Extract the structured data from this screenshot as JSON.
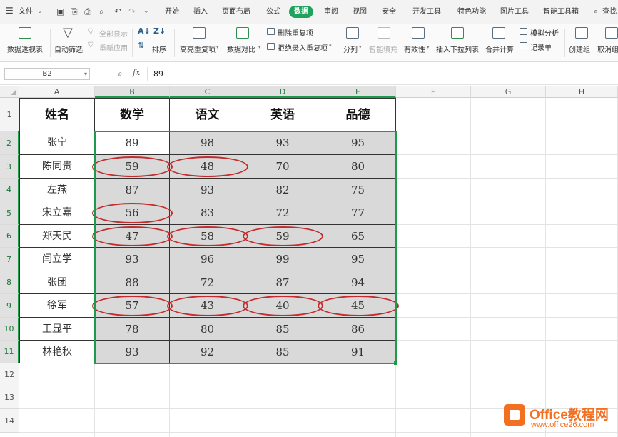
{
  "menubar": {
    "file": "文件",
    "tabs": [
      "开始",
      "插入",
      "页面布局",
      "公式",
      "数据",
      "审阅",
      "视图",
      "安全",
      "开发工具",
      "特色功能",
      "图片工具",
      "智能工具箱"
    ],
    "active_tab": "数据",
    "search": "查找"
  },
  "ribbon": {
    "pivot": "数据透视表",
    "autofilter": "自动筛选",
    "show_all": "全部显示",
    "reapply": "重新应用",
    "sort": "排序",
    "highlight_dup": "高亮重复项",
    "compare": "数据对比",
    "remove_dup": "删除重复项",
    "reject_dup": "拒绝录入重复项",
    "split": "分列",
    "smart_fill": "智能填充",
    "validity": "有效性",
    "dropdown_list": "插入下拉列表",
    "consolidate": "合并计算",
    "simulate": "模拟分析",
    "record_form": "记录单",
    "create_group": "创建组",
    "ungroup": "取消组"
  },
  "formula_bar": {
    "name_box": "B2",
    "fx": "fx",
    "value": "89"
  },
  "grid": {
    "columns": [
      "A",
      "B",
      "C",
      "D",
      "E",
      "F",
      "G",
      "H"
    ],
    "rows": [
      "1",
      "2",
      "3",
      "4",
      "5",
      "6",
      "7",
      "8",
      "9",
      "10",
      "11",
      "12",
      "13",
      "14"
    ],
    "headers": [
      "姓名",
      "数学",
      "语文",
      "英语",
      "品德"
    ],
    "records": [
      [
        "张宁",
        "89",
        "98",
        "93",
        "95"
      ],
      [
        "陈同贵",
        "59",
        "48",
        "70",
        "80"
      ],
      [
        "左燕",
        "87",
        "93",
        "82",
        "75"
      ],
      [
        "宋立嘉",
        "56",
        "83",
        "72",
        "77"
      ],
      [
        "郑天民",
        "47",
        "58",
        "59",
        "65"
      ],
      [
        "闫立学",
        "93",
        "96",
        "99",
        "95"
      ],
      [
        "张团",
        "88",
        "72",
        "87",
        "94"
      ],
      [
        "徐军",
        "57",
        "43",
        "40",
        "45"
      ],
      [
        "王显平",
        "78",
        "80",
        "85",
        "86"
      ],
      [
        "林艳秋",
        "93",
        "92",
        "85",
        "91"
      ]
    ],
    "selected_cell": "B2",
    "selected_range": "B2:E11",
    "circled_cells": [
      "B3",
      "C3",
      "B5",
      "B6",
      "C6",
      "D6",
      "B9",
      "C9",
      "D9",
      "E9"
    ]
  },
  "watermark": {
    "title": "Office教程网",
    "url": "www.office26.com"
  },
  "colors": {
    "accent_green": "#1da35c",
    "selection_green": "#1e9a4a",
    "circle_red": "#c52b2b",
    "highlight_gray": "#d9d9d9",
    "watermark_orange": "#f36f21"
  }
}
